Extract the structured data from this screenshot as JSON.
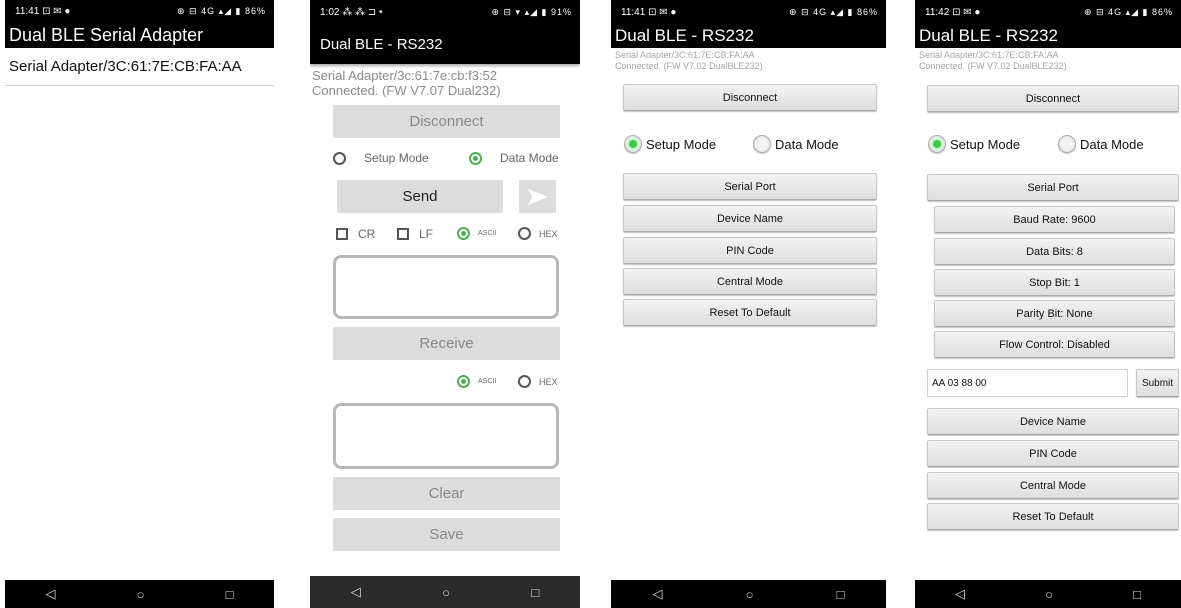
{
  "screen1": {
    "status_time": "11:41",
    "status_left_icons": "⊡ ✉ ●",
    "status_right_icons": "⊕ ⊟ 4G ▴◢ ▮",
    "status_battery": "86%",
    "title": "Dual BLE Serial Adapter",
    "device_item": "Serial Adapter/3C:61:7E:CB:FA:AA"
  },
  "screen2": {
    "status_time": "1:02",
    "status_left_icons": "⁂ ⁂ ⊐ •",
    "status_right_icons": "⊕ ⊟ ▾ ▴◢ ▮",
    "status_battery": "91%",
    "title": "Dual BLE - RS232",
    "info_line1": "Serial Adapter/3c:61:7e:cb:f3:52",
    "info_line2": "Connected. (FW V7.07 Dual232)",
    "disconnect": "Disconnect",
    "setup_mode": "Setup Mode",
    "data_mode": "Data Mode",
    "send": "Send",
    "cr": "CR",
    "lf": "LF",
    "ascii": "ASCII",
    "hex": "HEX",
    "receive": "Receive",
    "ascii2": "ASCII",
    "hex2": "HEX",
    "clear": "Clear",
    "save": "Save"
  },
  "screen3": {
    "status_time": "11:41",
    "status_left_icons": "⊡ ✉ ●",
    "status_right_icons": "⊕ ⊟ 4G ▴◢ ▮",
    "status_battery": "86%",
    "title": "Dual BLE - RS232",
    "info_line1": "Serial Adapter/3C:61:7E:CB:FA:AA",
    "info_line2": "Connected. (FW V7.02 DualBLE232)",
    "disconnect": "Disconnect",
    "setup_mode": "Setup Mode",
    "data_mode": "Data Mode",
    "menu": [
      "Serial Port",
      "Device Name",
      "PIN Code",
      "Central Mode",
      "Reset To Default"
    ]
  },
  "screen4": {
    "status_time": "11:42",
    "status_left_icons": "⊡ ✉ ●",
    "status_right_icons": "⊕ ⊟ 4G ▴◢ ▮",
    "status_battery": "86%",
    "title": "Dual BLE - RS232",
    "info_line1": "Serial Adapter/3C:61:7E:CB:FA:AA",
    "info_line2": "Connected. (FW V7.02 DualBLE232)",
    "disconnect": "Disconnect",
    "setup_mode": "Setup Mode",
    "data_mode": "Data Mode",
    "serial_port": "Serial Port",
    "sub": [
      "Baud Rate: 9600",
      "Data Bits: 8",
      "Stop Bit: 1",
      "Parity Bit: None",
      "Flow Control: Disabled"
    ],
    "command_value": "AA 03 88 00",
    "submit": "Submit",
    "menu": [
      "Device Name",
      "PIN Code",
      "Central Mode",
      "Reset To Default"
    ]
  },
  "nav": {
    "back": "◁",
    "home": "○",
    "recent": "□"
  },
  "colors": {
    "accent_green": "#4caf50",
    "appbar": "#000000",
    "button_gray": "#dcdcdc"
  }
}
